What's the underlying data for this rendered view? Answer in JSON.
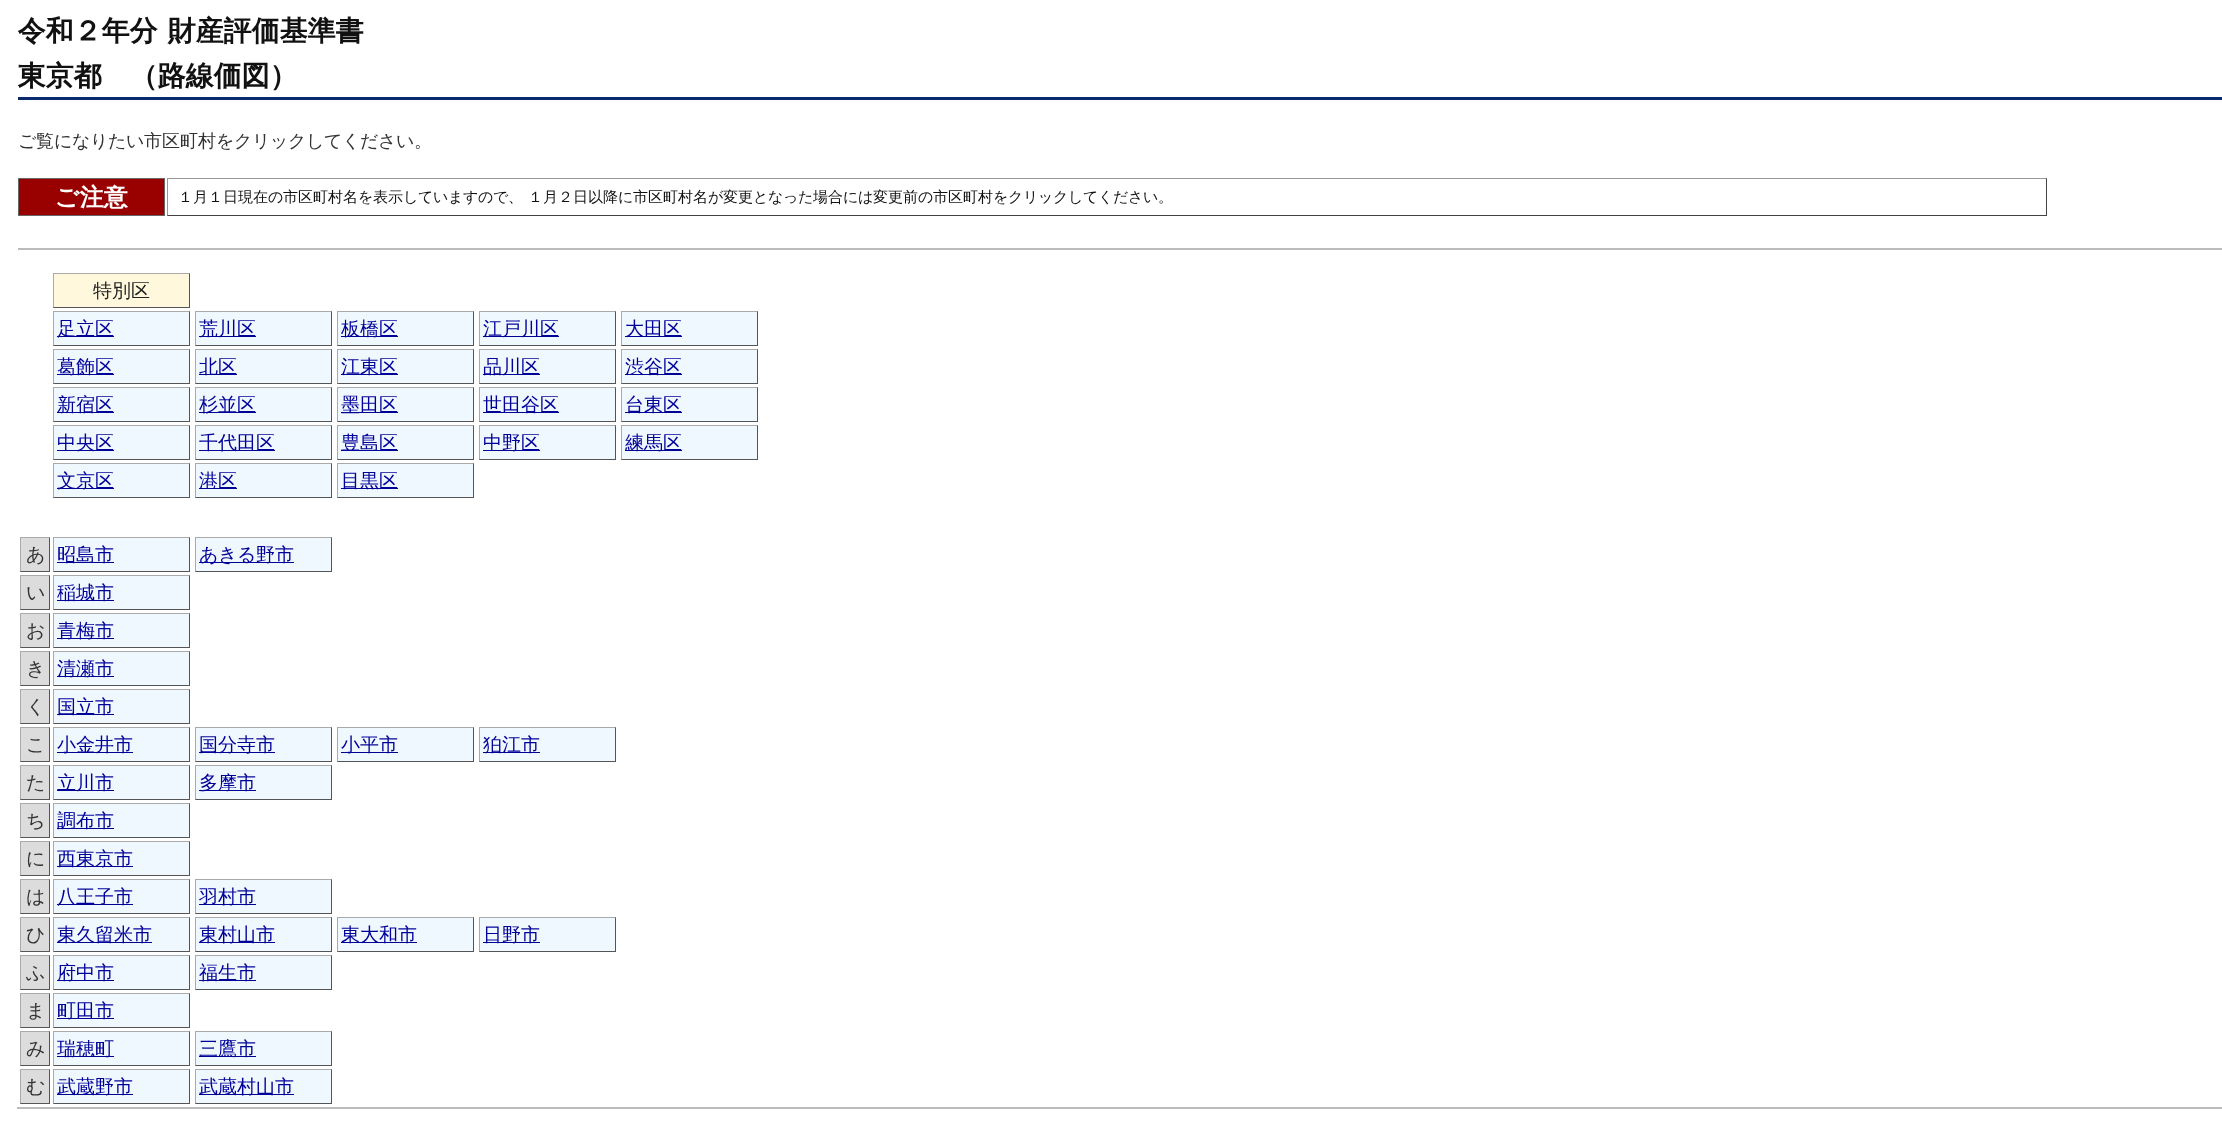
{
  "header": {
    "title": "令和２年分 財産評価基準書",
    "subtitle": "東京都　（路線価図）"
  },
  "instruction": "ご覧になりたい市区町村をクリックしてください。",
  "notice": {
    "label": "ご注意",
    "text": "１月１日現在の市区町村名を表示していますので、 １月２日以降に市区町村名が変更となった場合には変更前の市区町村をクリックしてください。"
  },
  "special_wards": {
    "heading": "特別区",
    "wards": [
      "足立区",
      "荒川区",
      "板橋区",
      "江戸川区",
      "大田区",
      "葛飾区",
      "北区",
      "江東区",
      "品川区",
      "渋谷区",
      "新宿区",
      "杉並区",
      "墨田区",
      "世田谷区",
      "台東区",
      "中央区",
      "千代田区",
      "豊島区",
      "中野区",
      "練馬区",
      "文京区",
      "港区",
      "目黒区"
    ]
  },
  "cities": [
    {
      "kana": "あ",
      "items": [
        "昭島市",
        "あきる野市"
      ]
    },
    {
      "kana": "い",
      "items": [
        "稲城市"
      ]
    },
    {
      "kana": "お",
      "items": [
        "青梅市"
      ]
    },
    {
      "kana": "き",
      "items": [
        "清瀬市"
      ]
    },
    {
      "kana": "く",
      "items": [
        "国立市"
      ]
    },
    {
      "kana": "こ",
      "items": [
        "小金井市",
        "国分寺市",
        "小平市",
        "狛江市"
      ]
    },
    {
      "kana": "た",
      "items": [
        "立川市",
        "多摩市"
      ]
    },
    {
      "kana": "ち",
      "items": [
        "調布市"
      ]
    },
    {
      "kana": "に",
      "items": [
        "西東京市"
      ]
    },
    {
      "kana": "は",
      "items": [
        "八王子市",
        "羽村市"
      ]
    },
    {
      "kana": "ひ",
      "items": [
        "東久留米市",
        "東村山市",
        "東大和市",
        "日野市"
      ]
    },
    {
      "kana": "ふ",
      "items": [
        "府中市",
        "福生市"
      ]
    },
    {
      "kana": "ま",
      "items": [
        "町田市"
      ]
    },
    {
      "kana": "み",
      "items": [
        "瑞穂町",
        "三鷹市"
      ]
    },
    {
      "kana": "む",
      "items": [
        "武蔵野市",
        "武蔵村山市"
      ]
    }
  ]
}
